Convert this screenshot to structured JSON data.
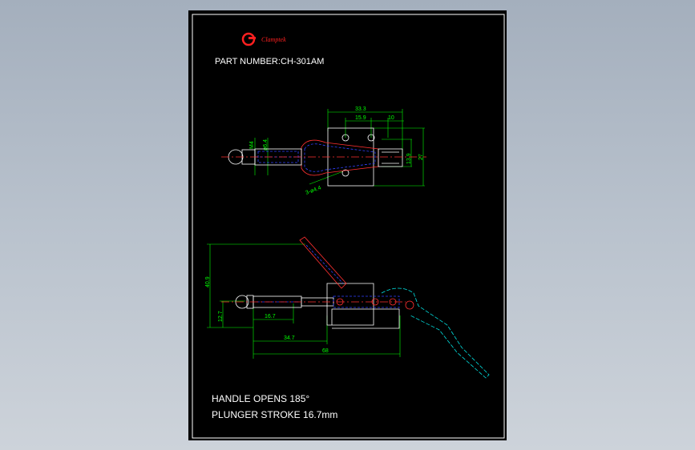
{
  "logo": {
    "brand": "Clamptek"
  },
  "title": {
    "part_label": "PART NUMBER:",
    "part_number": "CH-301AM"
  },
  "dims_top": {
    "overall_width": "33.3",
    "hole_spacing": "15.9",
    "edge_offset": "10",
    "height_inner": "13.9",
    "height_outer": "27",
    "thread": "M4",
    "rod_dia": "ø6.4",
    "holes": "3-ø4.4"
  },
  "dims_side": {
    "height": "40.9",
    "base_height": "12.7",
    "stroke": "16.7",
    "rod_len": "34.7",
    "overall": "68"
  },
  "notes": {
    "line1": "HANDLE OPENS   185°",
    "line2": "PLUNGER STROKE 16.7mm"
  },
  "colors": {
    "dimension": "#00ff00",
    "outline": "#ffffff",
    "hidden": "#3040ff",
    "red": "#ff3030",
    "cyan": "#00e0e0"
  }
}
